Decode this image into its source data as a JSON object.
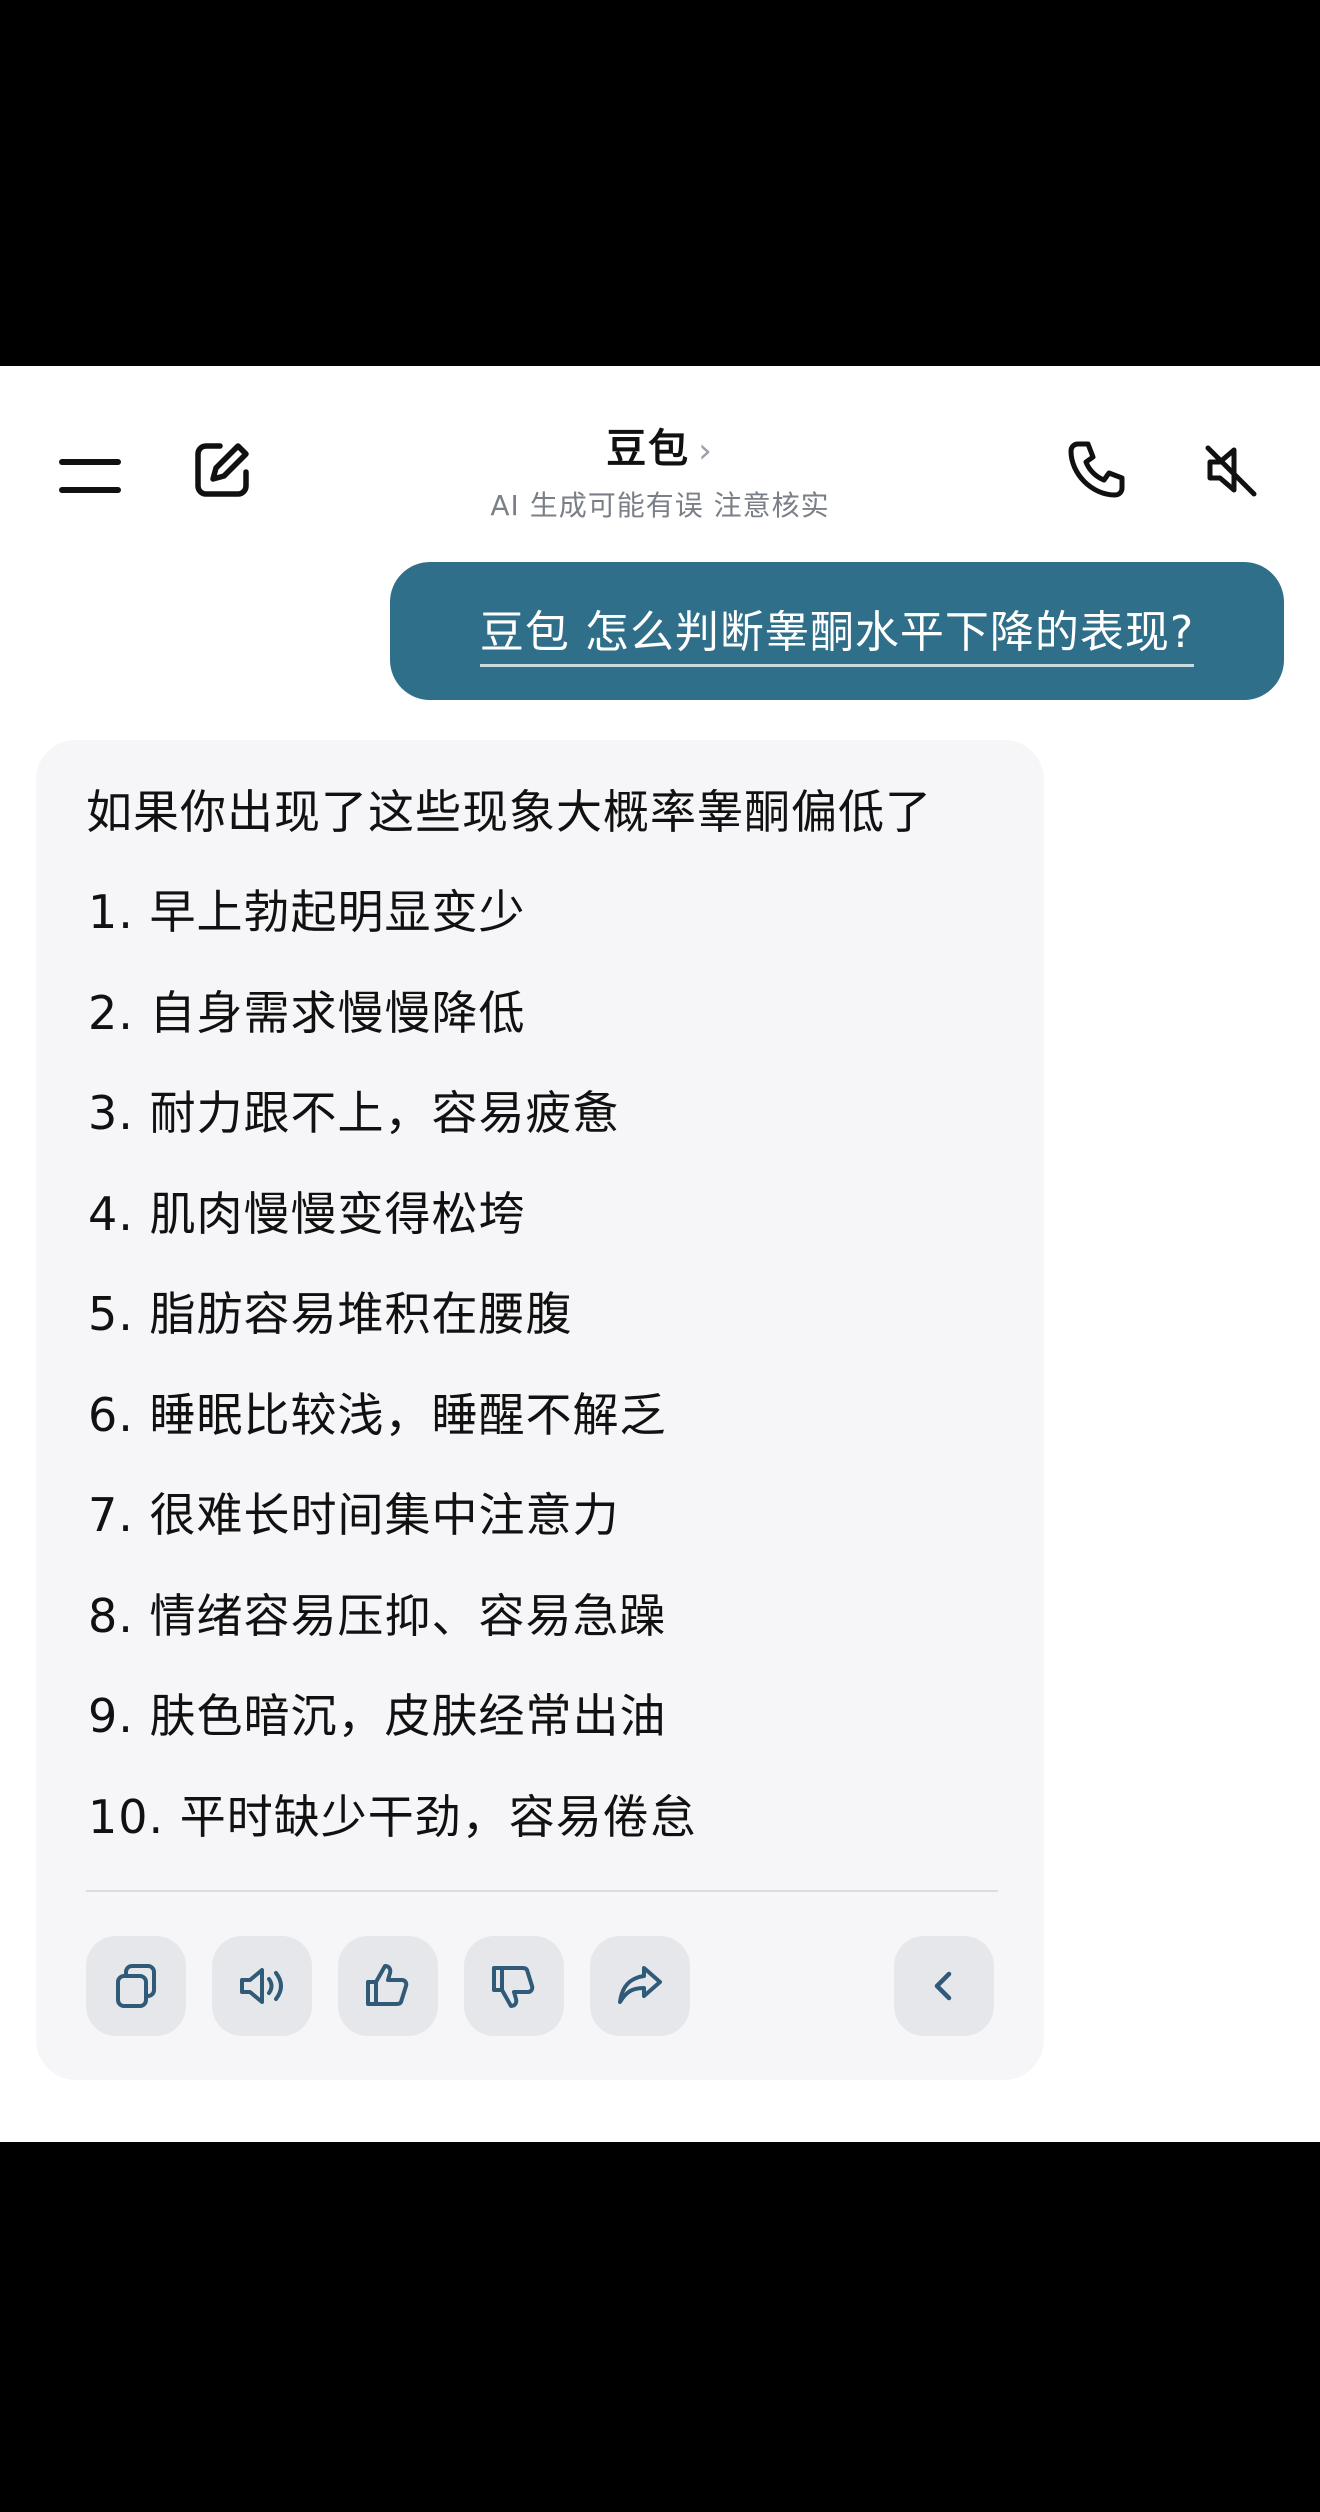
{
  "header": {
    "title": "豆包",
    "title_chevron": "›",
    "subtitle": "AI 生成可能有误 注意核实",
    "icons": [
      "menu-icon",
      "edit-icon",
      "phone-icon",
      "speaker-mute-icon"
    ]
  },
  "user_message": {
    "text": "豆包 怎么判断睾酮水平下降的表现?"
  },
  "assistant_message": {
    "intro": "如果你出现了这些现象大概率睾酮偏低了",
    "items": [
      "1.  早上勃起明显变少",
      "2.  自身需求慢慢降低",
      "3.  耐力跟不上，容易疲惫",
      "4.  肌肉慢慢变得松垮",
      "5.  脂肪容易堆积在腰腹",
      "6.  睡眠比较浅，睡醒不解乏",
      "7.  很难长时间集中注意力",
      "8.  情绪容易压抑、容易急躁",
      "9.  肤色暗沉，皮肤经常出油",
      "10.  平时缺少干劲，容易倦怠"
    ],
    "actions": [
      "copy-icon",
      "read-aloud-icon",
      "thumbs-up-icon",
      "thumbs-down-icon",
      "share-icon",
      "collapse-icon"
    ]
  },
  "colors": {
    "user_bubble": "#2f6f8a",
    "card_bg": "#f6f6f8",
    "action_bg": "#e6e7eb",
    "icon_stroke": "#2f5a78"
  }
}
